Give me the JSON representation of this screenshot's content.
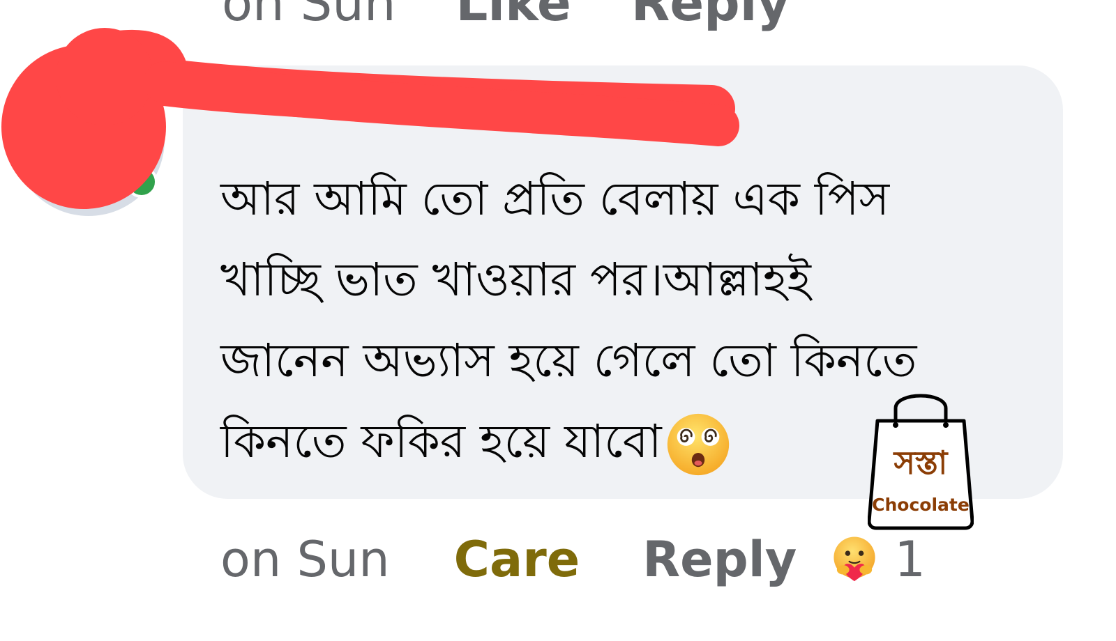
{
  "previous_comment": {
    "timestamp": "on Sun",
    "like_label": "Like",
    "reply_label": "Reply"
  },
  "comment": {
    "author_name": "",
    "text_lines": [
      "আর আমি তো প্রতি বেলায় এক পিস",
      "খাচ্ছি ভাত খাওয়ার পর।আল্লাহই",
      "জানেন অভ্যাস হয়ে গেলে তো কিনতে",
      "কিনতে ফকির হয়ে যাবো"
    ],
    "emoji": "dizzy-face-emoji",
    "timestamp": "on Sun",
    "reaction_button_label": "Care",
    "reply_label": "Reply",
    "reaction_icon": "care-reaction-icon",
    "reaction_count": "1"
  },
  "watermark": {
    "main_text": "সস্তা",
    "sub_text": "Chocolate"
  },
  "colors": {
    "bubble_bg": "#f0f2f5",
    "redaction": "#ff4747",
    "care_active": "#7f6b0a",
    "muted_text": "#65676b",
    "online_dot": "#31a24c",
    "watermark": "#8b3d05"
  }
}
